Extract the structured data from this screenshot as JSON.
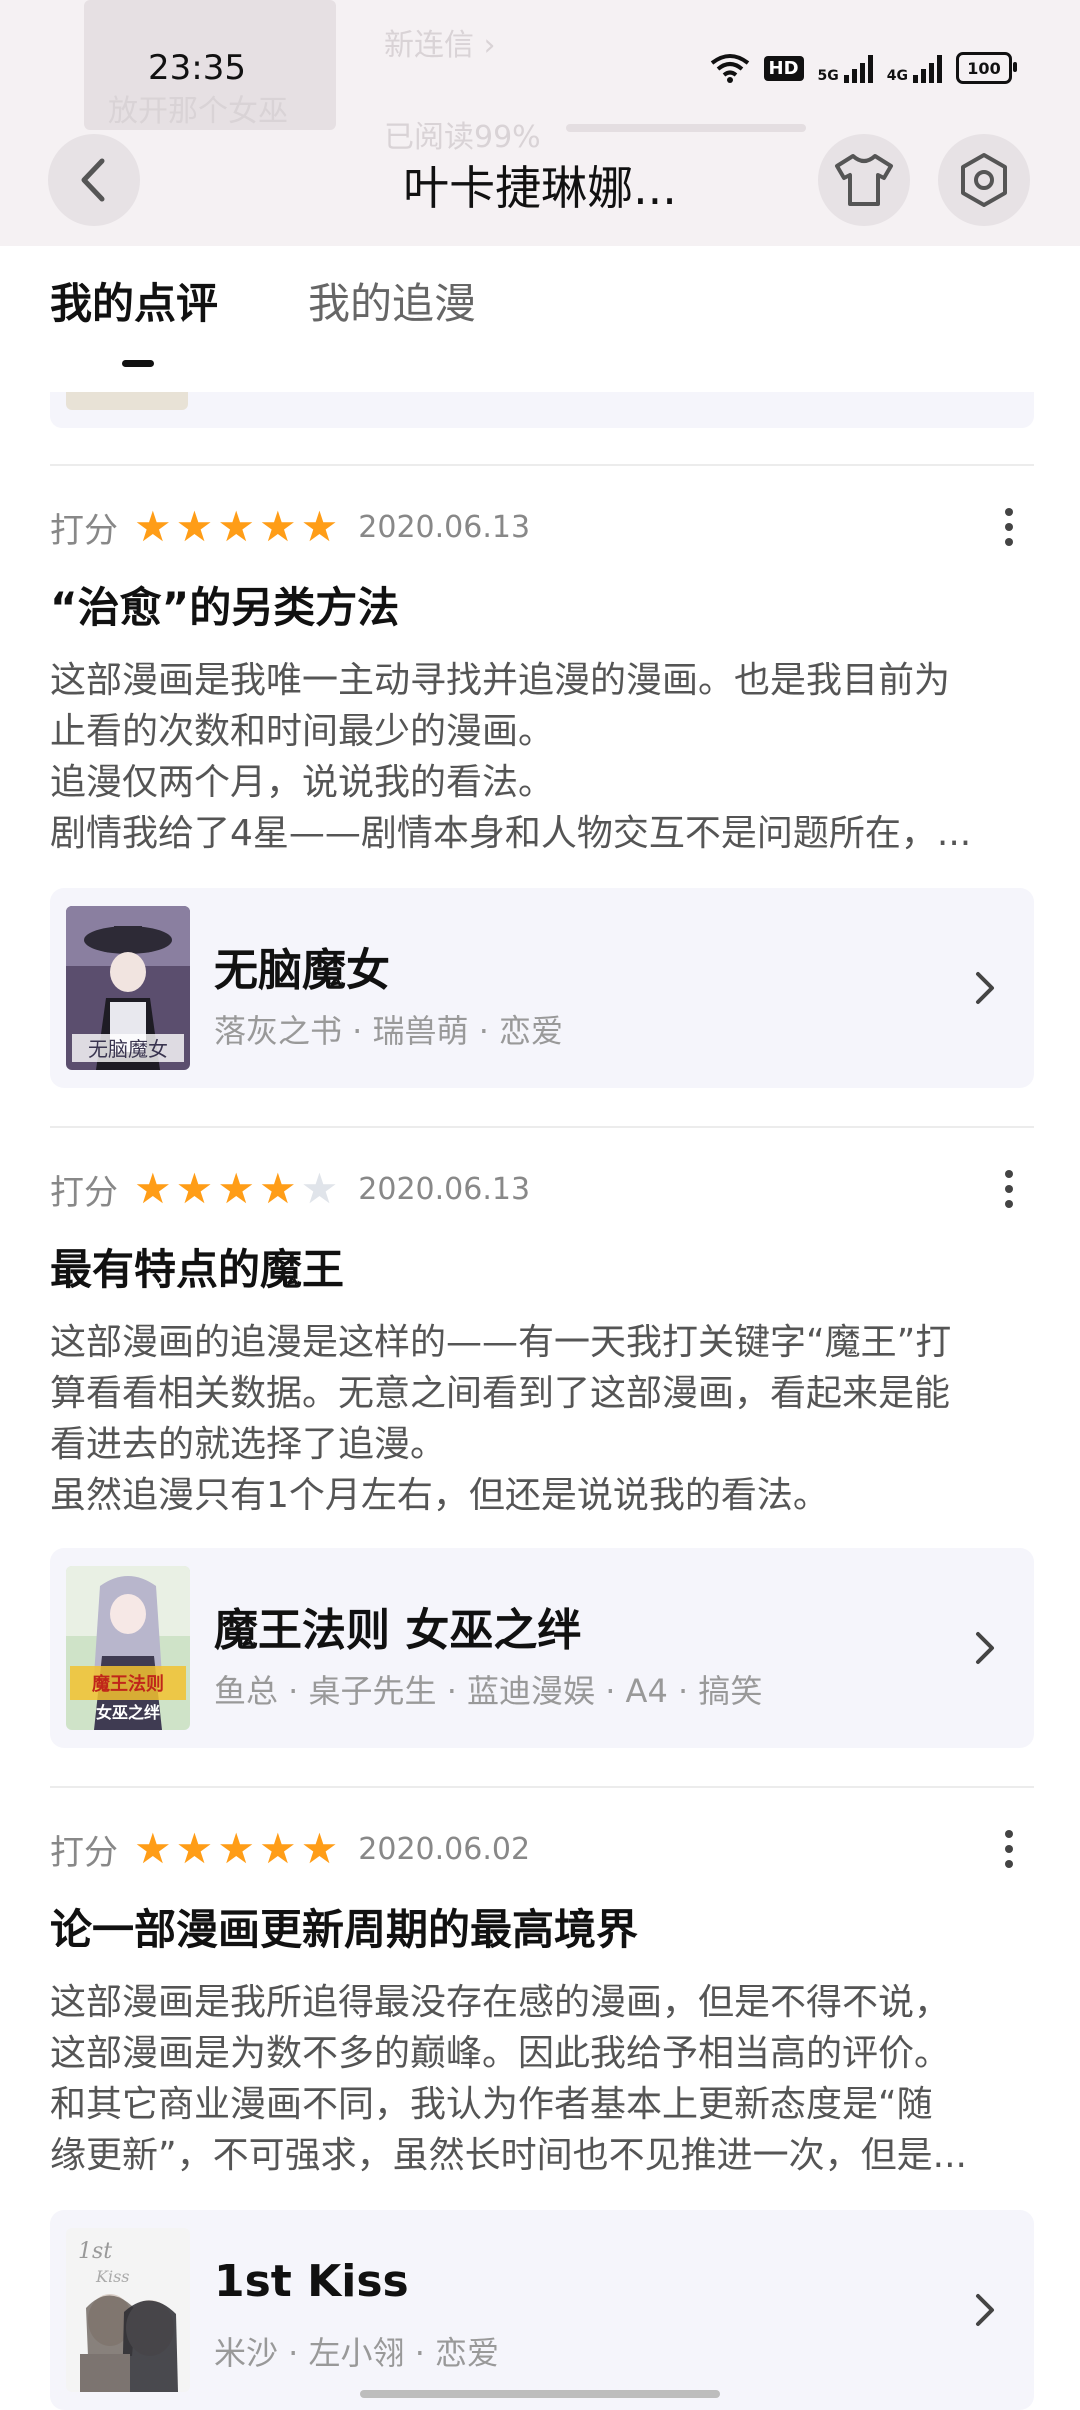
{
  "status_bar": {
    "time": "23:35",
    "hd": "HD",
    "net1": "5G",
    "net2": "4G",
    "battery": "100"
  },
  "header": {
    "ghost_text_1": "放开那个女巫",
    "ghost_text_2": "已阅读99%",
    "ghost_text_3": "新连信 ›",
    "title": "叶卡捷琳娜...",
    "back_icon": "chevron-left-icon",
    "skin_icon": "tshirt-icon",
    "settings_icon": "gear-icon"
  },
  "tabs": [
    {
      "label": "我的点评",
      "active": true
    },
    {
      "label": "我的追漫",
      "active": false
    }
  ],
  "reviews": [
    {
      "rating_label": "打分",
      "stars": 5,
      "date": "2020.06.13",
      "title": "“治愈”的另类方法",
      "lines": [
        "这部漫画是我唯一主动寻找并追漫的漫画。也是我目前为",
        "止看的次数和时间最少的漫画。",
        "追漫仅两个月，说说我的看法。",
        "剧情我给了4星——剧情本身和人物交互不是问题所在，..."
      ],
      "comic": {
        "name": "无脑魔女",
        "meta": "落灰之书 · 瑞兽萌 · 恋爱"
      }
    },
    {
      "rating_label": "打分",
      "stars": 4,
      "date": "2020.06.13",
      "title": "最有特点的魔王",
      "lines": [
        "这部漫画的追漫是这样的——有一天我打关键字“魔王”打",
        "算看看相关数据。无意之间看到了这部漫画，看起来是能",
        "看进去的就选择了追漫。",
        "虽然追漫只有1个月左右，但还是说说我的看法。"
      ],
      "comic": {
        "name": "魔王法则 女巫之绊",
        "meta": "鱼总 · 桌子先生 · 蓝迪漫娱 · A4 · 搞笑"
      }
    },
    {
      "rating_label": "打分",
      "stars": 5,
      "date": "2020.06.02",
      "title": "论一部漫画更新周期的最高境界",
      "lines": [
        "这部漫画是我所追得最没存在感的漫画，但是不得不说，",
        "这部漫画是为数不多的巅峰。因此我给予相当高的评价。",
        "和其它商业漫画不同，我认为作者基本上更新态度是“随",
        "缘更新”，不可强求，虽然长时间也不见推进一次，但是..."
      ],
      "comic": {
        "name": "1st Kiss",
        "meta": "米沙 · 左小翎 · 恋爱"
      }
    }
  ],
  "colors": {
    "star_on": "#ff9d17",
    "star_off": "#e0e4ea",
    "card_bg": "#f5f5fb",
    "header_bg": "#f5f1f3"
  }
}
